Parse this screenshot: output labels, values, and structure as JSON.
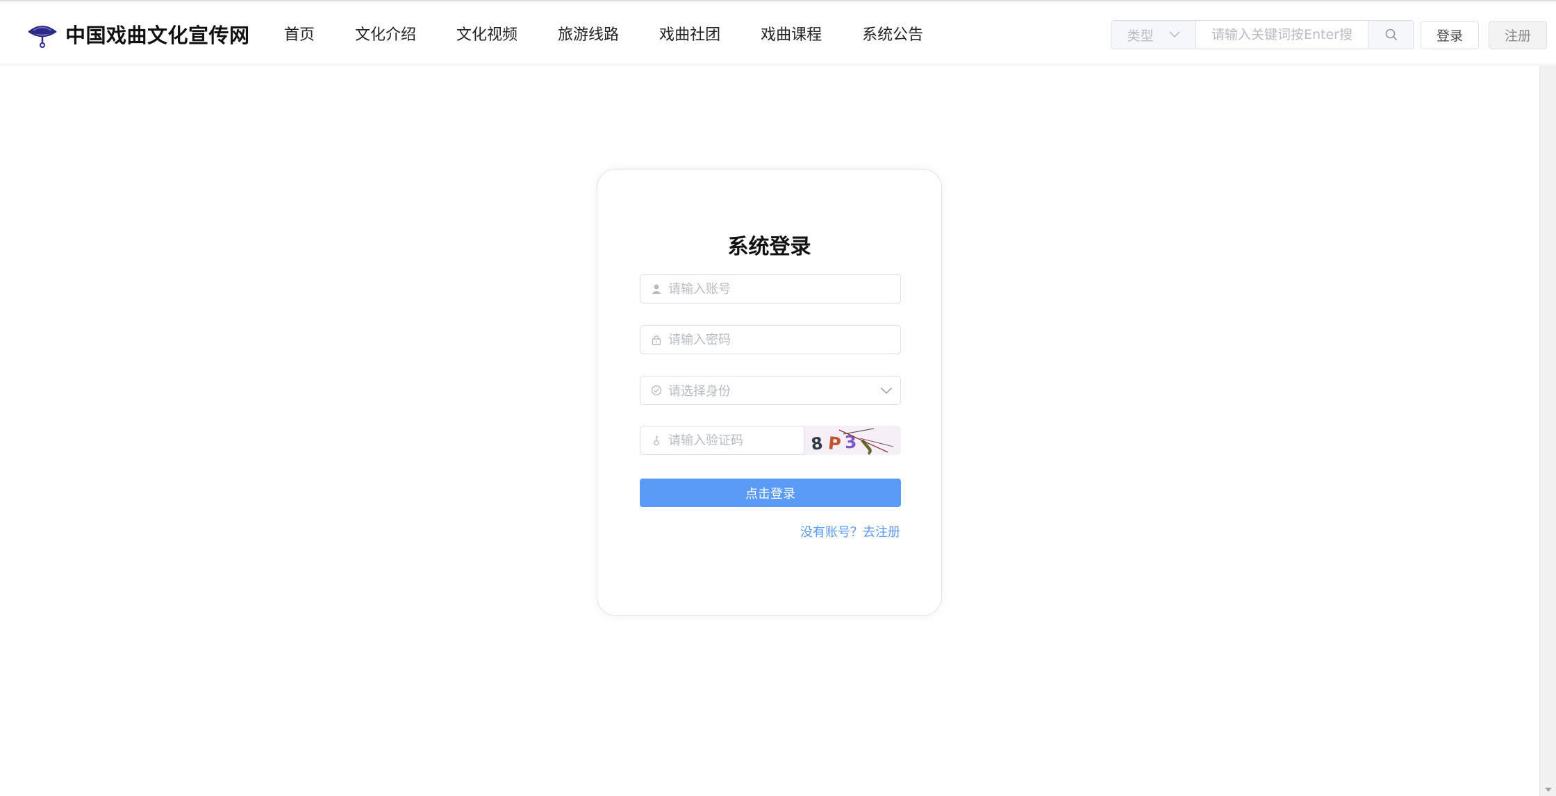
{
  "site": {
    "title": "中国戏曲文化宣传网"
  },
  "nav": [
    {
      "label": "首页"
    },
    {
      "label": "文化介绍"
    },
    {
      "label": "文化视频"
    },
    {
      "label": "旅游线路"
    },
    {
      "label": "戏曲社团"
    },
    {
      "label": "戏曲课程"
    },
    {
      "label": "系统公告"
    }
  ],
  "search": {
    "type_label": "类型",
    "placeholder": "请输入关键词按Enter搜索",
    "icon": "search-icon"
  },
  "header_buttons": {
    "login": "登录",
    "register": "注册"
  },
  "login_form": {
    "title": "系统登录",
    "account_placeholder": "请输入账号",
    "password_placeholder": "请输入密码",
    "role_placeholder": "请选择身份",
    "captcha_placeholder": "请输入验证码",
    "captcha_text": "8P3J",
    "submit_label": "点击登录",
    "register_link": "没有账号？去注册"
  },
  "colors": {
    "primary": "#5b9bf8",
    "logo": "#2b2a86",
    "placeholder": "#b7bbc2"
  }
}
